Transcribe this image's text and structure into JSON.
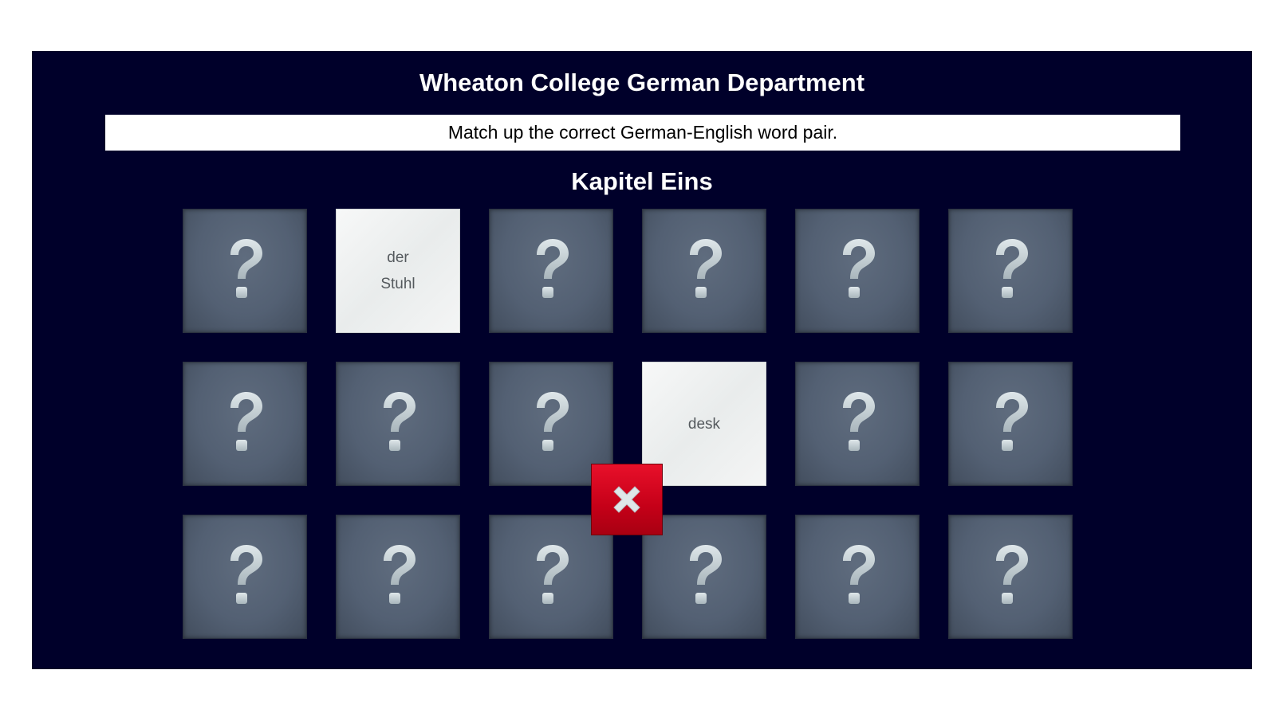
{
  "header": {
    "title": "Wheaton College German Department"
  },
  "instructions": "Match up the correct German-English word pair.",
  "chapter_title": "Kapitel Eins",
  "cards": [
    {
      "state": "hidden",
      "text": ""
    },
    {
      "state": "revealed",
      "text": "der\nStuhl"
    },
    {
      "state": "hidden",
      "text": ""
    },
    {
      "state": "hidden",
      "text": ""
    },
    {
      "state": "hidden",
      "text": ""
    },
    {
      "state": "hidden",
      "text": ""
    },
    {
      "state": "hidden",
      "text": ""
    },
    {
      "state": "hidden",
      "text": ""
    },
    {
      "state": "hidden",
      "text": ""
    },
    {
      "state": "revealed",
      "text": "desk"
    },
    {
      "state": "hidden",
      "text": ""
    },
    {
      "state": "hidden",
      "text": ""
    },
    {
      "state": "hidden",
      "text": ""
    },
    {
      "state": "hidden",
      "text": ""
    },
    {
      "state": "hidden",
      "text": ""
    },
    {
      "state": "hidden",
      "text": ""
    },
    {
      "state": "hidden",
      "text": ""
    },
    {
      "state": "hidden",
      "text": ""
    }
  ],
  "feedback": {
    "result": "incorrect",
    "icon": "close-icon",
    "color": "#d0021b"
  },
  "colors": {
    "panel_background": "#00002a",
    "card_back": "#536073",
    "card_front": "#f0f2f2"
  }
}
